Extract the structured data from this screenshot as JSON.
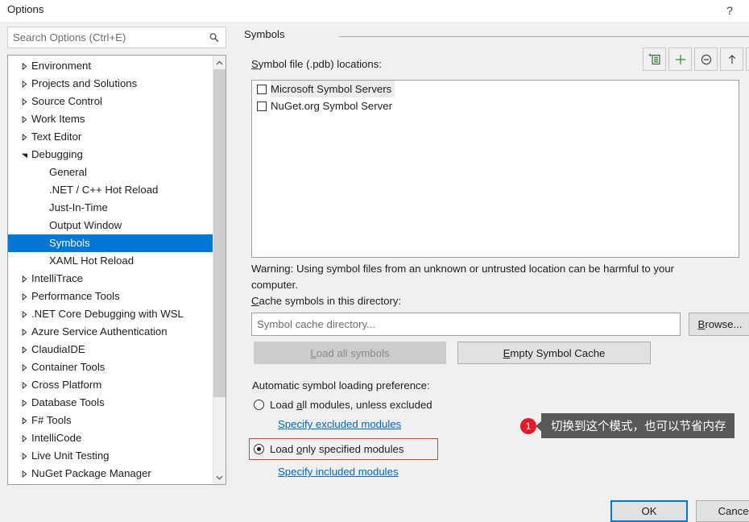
{
  "window": {
    "title": "Options",
    "help_icon": "question-mark-icon"
  },
  "search": {
    "placeholder": "Search Options (Ctrl+E)",
    "value": "",
    "icon": "search-icon"
  },
  "tree": {
    "items": [
      {
        "label": "Environment",
        "level": 0,
        "expandable": true,
        "expanded": false,
        "selected": false
      },
      {
        "label": "Projects and Solutions",
        "level": 0,
        "expandable": true,
        "expanded": false,
        "selected": false
      },
      {
        "label": "Source Control",
        "level": 0,
        "expandable": true,
        "expanded": false,
        "selected": false
      },
      {
        "label": "Work Items",
        "level": 0,
        "expandable": true,
        "expanded": false,
        "selected": false
      },
      {
        "label": "Text Editor",
        "level": 0,
        "expandable": true,
        "expanded": false,
        "selected": false
      },
      {
        "label": "Debugging",
        "level": 0,
        "expandable": true,
        "expanded": true,
        "selected": false
      },
      {
        "label": "General",
        "level": 1,
        "expandable": false,
        "expanded": false,
        "selected": false
      },
      {
        "label": ".NET / C++ Hot Reload",
        "level": 1,
        "expandable": false,
        "expanded": false,
        "selected": false
      },
      {
        "label": "Just-In-Time",
        "level": 1,
        "expandable": false,
        "expanded": false,
        "selected": false
      },
      {
        "label": "Output Window",
        "level": 1,
        "expandable": false,
        "expanded": false,
        "selected": false
      },
      {
        "label": "Symbols",
        "level": 1,
        "expandable": false,
        "expanded": false,
        "selected": true
      },
      {
        "label": "XAML Hot Reload",
        "level": 1,
        "expandable": false,
        "expanded": false,
        "selected": false
      },
      {
        "label": "IntelliTrace",
        "level": 0,
        "expandable": true,
        "expanded": false,
        "selected": false
      },
      {
        "label": "Performance Tools",
        "level": 0,
        "expandable": true,
        "expanded": false,
        "selected": false
      },
      {
        "label": ".NET Core Debugging with WSL",
        "level": 0,
        "expandable": true,
        "expanded": false,
        "selected": false
      },
      {
        "label": "Azure Service Authentication",
        "level": 0,
        "expandable": true,
        "expanded": false,
        "selected": false
      },
      {
        "label": "ClaudiaIDE",
        "level": 0,
        "expandable": true,
        "expanded": false,
        "selected": false
      },
      {
        "label": "Container Tools",
        "level": 0,
        "expandable": true,
        "expanded": false,
        "selected": false
      },
      {
        "label": "Cross Platform",
        "level": 0,
        "expandable": true,
        "expanded": false,
        "selected": false
      },
      {
        "label": "Database Tools",
        "level": 0,
        "expandable": true,
        "expanded": false,
        "selected": false
      },
      {
        "label": "F# Tools",
        "level": 0,
        "expandable": true,
        "expanded": false,
        "selected": false
      },
      {
        "label": "IntelliCode",
        "level": 0,
        "expandable": true,
        "expanded": false,
        "selected": false
      },
      {
        "label": "Live Unit Testing",
        "level": 0,
        "expandable": true,
        "expanded": false,
        "selected": false
      },
      {
        "label": "NuGet Package Manager",
        "level": 0,
        "expandable": true,
        "expanded": false,
        "selected": false
      }
    ],
    "scrollbar": {
      "up_icon": "chevron-up-icon",
      "down_icon": "chevron-down-icon"
    }
  },
  "panel": {
    "title": "Symbols",
    "locations_label_prefix": "S",
    "locations_label_rest": "ymbol file (.pdb) locations:",
    "toolbar": [
      {
        "name": "new-symbol-location-button",
        "icon": "new-list-entry-icon"
      },
      {
        "name": "add-symbol-location-button",
        "icon": "plus-icon"
      },
      {
        "name": "remove-symbol-location-button",
        "icon": "minus-circle-icon"
      },
      {
        "name": "move-up-button",
        "icon": "arrow-up-icon"
      },
      {
        "name": "move-down-button",
        "icon": "arrow-down-icon"
      }
    ],
    "symbol_servers": [
      {
        "label": "Microsoft Symbol Servers",
        "checked": false,
        "selected": true
      },
      {
        "label": "NuGet.org Symbol Server",
        "checked": false,
        "selected": false
      }
    ],
    "warning_line1": "Warning: Using symbol files from an unknown or untrusted location can be harmful to your",
    "warning_line2": "computer.",
    "cache_label_prefix": "C",
    "cache_label_rest": "ache symbols in this directory:",
    "cache_input": {
      "placeholder": "Symbol cache directory...",
      "value": ""
    },
    "browse_button": {
      "accel": "B",
      "rest": "rowse..."
    },
    "load_all_symbols_button": {
      "accel": "L",
      "rest": "oad all symbols",
      "enabled": false
    },
    "empty_symbol_cache_button": {
      "accel": "E",
      "rest": "mpty Symbol Cache",
      "enabled": true
    },
    "auto_load_label": "Automatic symbol loading preference:",
    "radios": [
      {
        "pre": "Load ",
        "accel": "a",
        "post": "ll modules, unless excluded",
        "selected": false,
        "link": "Specify excluded modules"
      },
      {
        "pre": "Load ",
        "accel": "o",
        "post": "nly specified modules",
        "selected": true,
        "link": "Specify included modules"
      }
    ]
  },
  "annotation": {
    "badge": "1",
    "tooltip": "切换到这个模式，也可以节省内存",
    "highlight_color": "#e23b2e"
  },
  "footer": {
    "ok_label": "OK",
    "cancel_label": "Cancel"
  }
}
